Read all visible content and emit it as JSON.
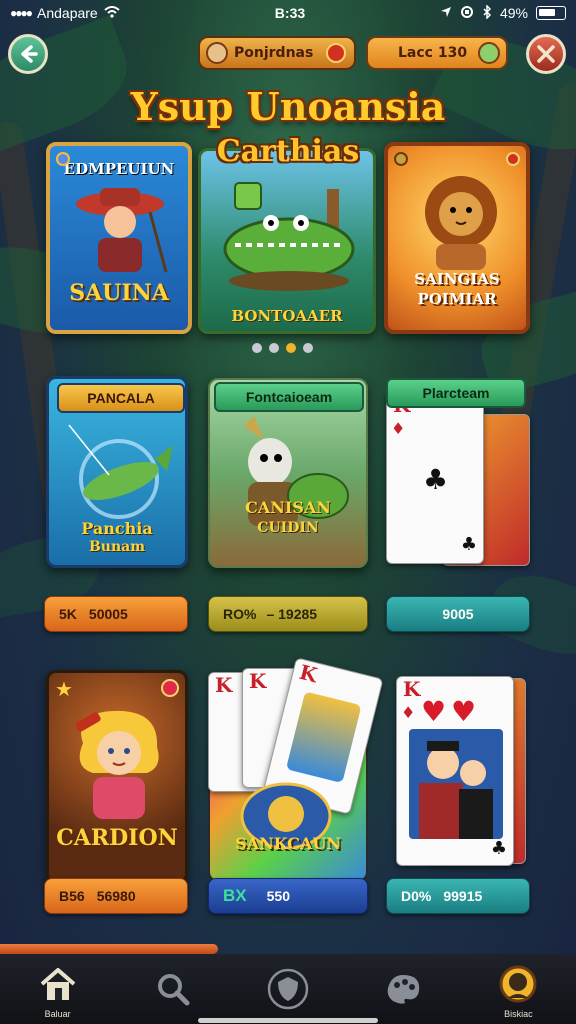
{
  "status_bar": {
    "carrier": "Andapare",
    "time": "B:33",
    "battery": "49%"
  },
  "header": {
    "left_pill_label": "Ponjrdnas",
    "right_pill_label": "Lacc 130",
    "title": "Ysup Unoansia",
    "subtitle": "Carthias"
  },
  "featured": [
    {
      "label_top": "EDMPEUIUN",
      "label_bottom": "SAUINA"
    },
    {
      "label_bottom": "BONTOAAER"
    },
    {
      "label_top": "SAINGIAS",
      "label_bottom": "POIMIAR"
    }
  ],
  "carousel": {
    "page_count": 4,
    "active_index": 2
  },
  "grid_row1": [
    {
      "ribbon": "PANCALA",
      "label_top": "Panchia",
      "label_bottom": "Bunam"
    },
    {
      "ribbon": "Fontcaioeam",
      "label_top": "CANISAN",
      "label_bottom": "CUIDIN"
    },
    {
      "ribbon": "Plarcteam",
      "card_rank": "K"
    }
  ],
  "stats_row1": [
    {
      "prefix": "5K",
      "value": "50005"
    },
    {
      "prefix": "RO%",
      "value": "– 19285"
    },
    {
      "prefix": "",
      "value": "9005"
    }
  ],
  "grid_row2": [
    {
      "label": "CARDION"
    },
    {
      "label": "SANKCAUN",
      "card_rank": "K"
    },
    {
      "card_rank": "K"
    }
  ],
  "stats_row2": [
    {
      "prefix": "B56",
      "value": "56980"
    },
    {
      "prefix": "BX",
      "value": "550"
    },
    {
      "prefix": "D0%",
      "value": "99915"
    }
  ],
  "bottom_nav": [
    {
      "icon": "home-icon",
      "label": "Baluar"
    },
    {
      "icon": "search-icon",
      "label": ""
    },
    {
      "icon": "shield-icon",
      "label": ""
    },
    {
      "icon": "palette-icon",
      "label": ""
    },
    {
      "icon": "profile-badge-icon",
      "label": "Biskiac"
    }
  ],
  "colors": {
    "gold": "#ffcc2b",
    "orange": "#f8a03a",
    "teal": "#3ab6b2",
    "blue": "#3a66c8"
  }
}
